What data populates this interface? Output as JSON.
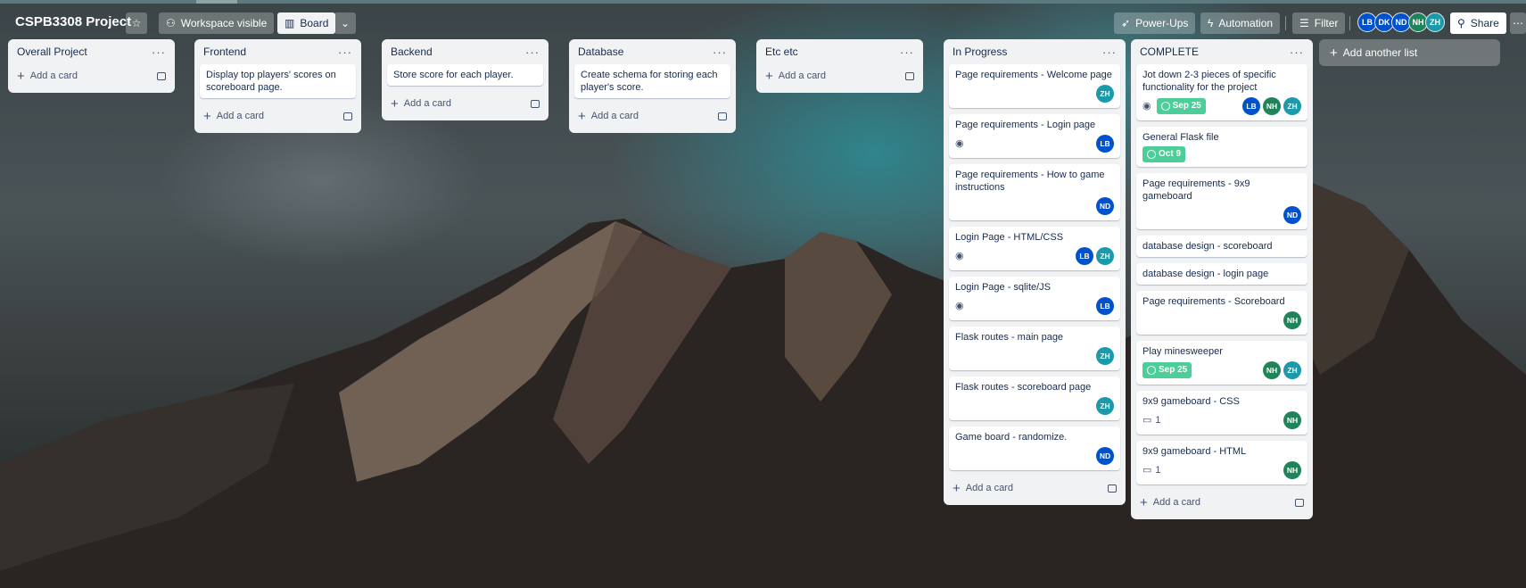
{
  "board": {
    "title": "CSPB3308 Project",
    "visibility_label": "Workspace visible",
    "view_label": "Board",
    "powerups_label": "Power-Ups",
    "automation_label": "Automation",
    "filter_label": "Filter",
    "share_label": "Share",
    "members": [
      "LB",
      "DK",
      "ND",
      "NH",
      "ZH"
    ]
  },
  "common": {
    "add_card_label": "Add a card",
    "add_list_label": "Add another list",
    "menu_dots": "···"
  },
  "lists": [
    {
      "title": "Overall Project",
      "cards": []
    },
    {
      "title": "Frontend",
      "cards": [
        {
          "text": "Display top players' scores on scoreboard page."
        }
      ]
    },
    {
      "title": "Backend",
      "cards": [
        {
          "text": "Store score for each player."
        }
      ]
    },
    {
      "title": "Database",
      "cards": [
        {
          "text": "Create schema for storing each player's score."
        }
      ]
    },
    {
      "title": "Etc etc",
      "cards": []
    },
    {
      "title": "In Progress",
      "cards": [
        {
          "text": "Page requirements - Welcome page",
          "members": [
            "ZH"
          ]
        },
        {
          "text": "Page requirements - Login page",
          "watch": true,
          "members": [
            "LB"
          ]
        },
        {
          "text": "Page requirements - How to game instructions",
          "members": [
            "ND"
          ]
        },
        {
          "text": "Login Page - HTML/CSS",
          "watch": true,
          "members": [
            "LB",
            "ZH"
          ]
        },
        {
          "text": "Login Page - sqlite/JS",
          "watch": true,
          "members": [
            "LB"
          ]
        },
        {
          "text": "Flask routes - main page",
          "members": [
            "ZH"
          ]
        },
        {
          "text": "Flask routes - scoreboard page",
          "members": [
            "ZH"
          ]
        },
        {
          "text": "Game board - randomize.",
          "members": [
            "ND"
          ]
        }
      ]
    },
    {
      "title": "COMPLETE",
      "cards": [
        {
          "text": "Jot down 2-3 pieces of specific functionality for the project",
          "watch": true,
          "due": "Sep 25",
          "members": [
            "LB",
            "NH",
            "ZH"
          ]
        },
        {
          "text": "General Flask file",
          "due": "Oct 9"
        },
        {
          "text": "Page requirements - 9x9 gameboard",
          "members": [
            "ND"
          ]
        },
        {
          "text": "database design - scoreboard"
        },
        {
          "text": "database design - login page"
        },
        {
          "text": "Page requirements - Scoreboard",
          "members": [
            "NH"
          ]
        },
        {
          "text": "Play minesweeper",
          "due": "Sep 25",
          "members": [
            "NH",
            "ZH"
          ]
        },
        {
          "text": "9x9 gameboard - CSS",
          "comments": "1",
          "members": [
            "NH"
          ]
        },
        {
          "text": "9x9 gameboard - HTML",
          "comments": "1",
          "members": [
            "NH"
          ]
        }
      ]
    }
  ],
  "colors": {
    "due_green": "#4bce97",
    "member_blue": "#0052cc",
    "member_green": "#1f845a",
    "member_teal": "#1d9aaa"
  },
  "icons": [
    "star-icon",
    "people-icon",
    "board-icon",
    "chevron-down-icon",
    "rocket-icon",
    "bolt-icon",
    "filter-icon",
    "share-icon",
    "more-icon",
    "eye-icon",
    "clock-icon",
    "comment-icon",
    "template-icon",
    "plus-icon"
  ]
}
